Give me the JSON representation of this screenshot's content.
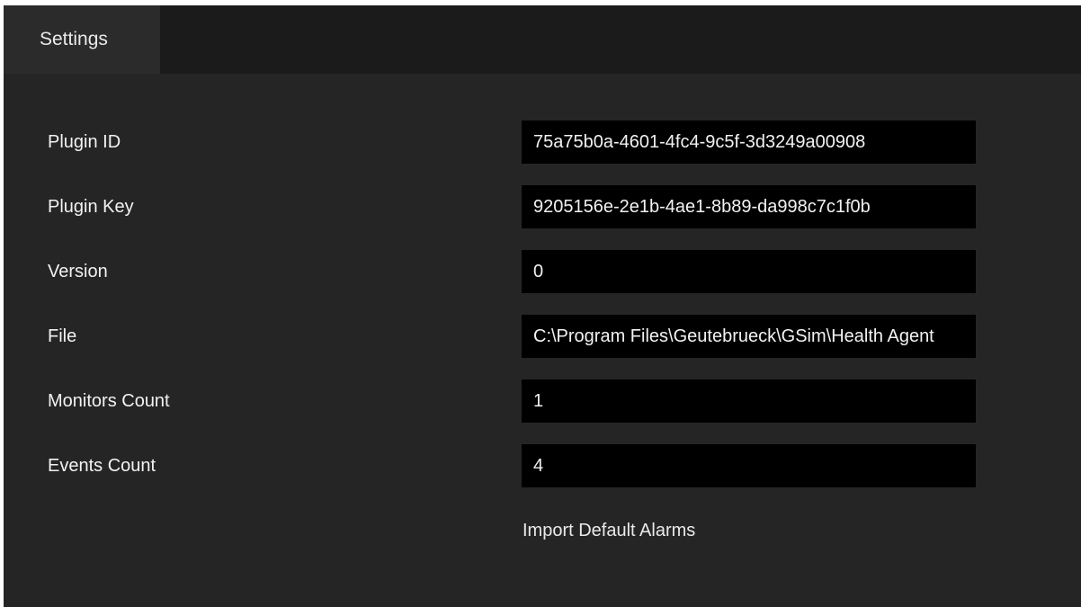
{
  "tabs": [
    {
      "label": "Settings",
      "active": true
    }
  ],
  "fields": {
    "plugin_id": {
      "label": "Plugin ID",
      "value": "75a75b0a-4601-4fc4-9c5f-3d3249a00908"
    },
    "plugin_key": {
      "label": "Plugin Key",
      "value": "9205156e-2e1b-4ae1-8b89-da998c7c1f0b"
    },
    "version": {
      "label": "Version",
      "value": "0"
    },
    "file": {
      "label": "File",
      "value": "C:\\Program Files\\Geutebrueck\\GSim\\Health Agent"
    },
    "monitors_count": {
      "label": "Monitors Count",
      "value": "1"
    },
    "events_count": {
      "label": "Events Count",
      "value": "4"
    }
  },
  "actions": {
    "import_default_alarms": "Import Default Alarms"
  },
  "colors": {
    "window_bg": "#252525",
    "tabbar_bg": "#1b1b1b",
    "tab_active_bg": "#2b2b2b",
    "field_bg": "#000000",
    "text": "#f2f2f2"
  }
}
